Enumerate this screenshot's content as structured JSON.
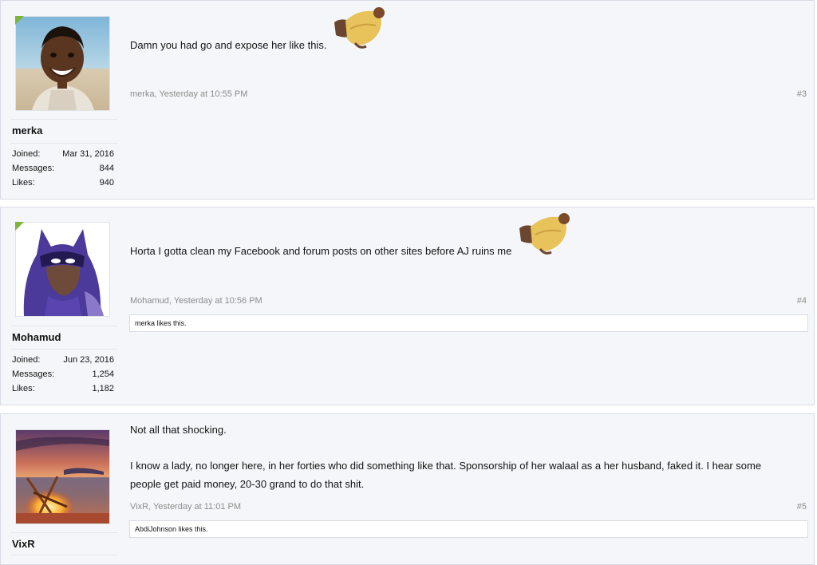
{
  "posts": [
    {
      "username": "merka",
      "avatar_icon": "smiling-boy-avatar-icon",
      "online": true,
      "stats": [
        {
          "label": "Joined:",
          "value": "Mar 31, 2016"
        },
        {
          "label": "Messages:",
          "value": "844"
        },
        {
          "label": "Likes:",
          "value": "940"
        }
      ],
      "message_lines": [
        "Damn you had go and expose her like this."
      ],
      "emoji_icon": "crawling-man-emoji-icon",
      "meta": "merka, Yesterday at 10:55 PM",
      "number": "#3",
      "likes_text": ""
    },
    {
      "username": "Mohamud",
      "avatar_icon": "hooded-hero-avatar-icon",
      "online": true,
      "stats": [
        {
          "label": "Joined:",
          "value": "Jun 23, 2016"
        },
        {
          "label": "Messages:",
          "value": "1,254"
        },
        {
          "label": "Likes:",
          "value": "1,182"
        }
      ],
      "message_lines": [
        "Horta I gotta clean my Facebook and forum posts on other sites before AJ ruins me"
      ],
      "emoji_icon": "crawling-man-emoji-icon",
      "meta": "Mohamud, Yesterday at 10:56 PM",
      "number": "#4",
      "likes_text": "merka likes this."
    },
    {
      "username": "VixR",
      "avatar_icon": "beach-campfire-avatar-icon",
      "online": false,
      "message_lines": [
        "Not all that shocking.",
        "I know a lady, no longer here, in her forties who did something like that. Sponsorship of her walaal as a her husband, faked it. I hear some",
        "people get paid money, 20-30 grand to do that shit."
      ],
      "meta": "VixR, Yesterday at 11:01 PM",
      "number": "#5",
      "likes_text": "AbdiJohnson likes this."
    }
  ]
}
